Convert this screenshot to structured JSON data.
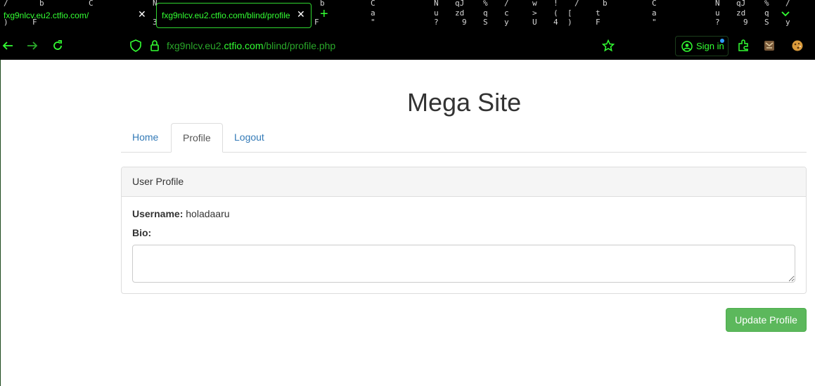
{
  "browser": {
    "tabs": [
      {
        "title": "fxg9nlcv.eu2.ctfio.com/",
        "close": "✕"
      },
      {
        "title": "fxg9nlcv.eu2.ctfio.com/blind/profile",
        "close": "✕"
      }
    ],
    "new_tab": "+",
    "url_prefix": "fxg9nlcv.eu2.",
    "url_domain": "ctfio.com",
    "url_path": "/blind/profile.php",
    "signin_label": "Sign in",
    "theme_color": "#33ff33"
  },
  "site": {
    "title": "Mega Site",
    "nav": [
      {
        "label": "Home",
        "active": false
      },
      {
        "label": "Profile",
        "active": true
      },
      {
        "label": "Logout",
        "active": false
      }
    ]
  },
  "profile": {
    "panel_heading": "User Profile",
    "username_label": "Username:",
    "username_value": "holadaaru",
    "bio_label": "Bio:",
    "bio_value": "",
    "update_button": "Update Profile"
  }
}
